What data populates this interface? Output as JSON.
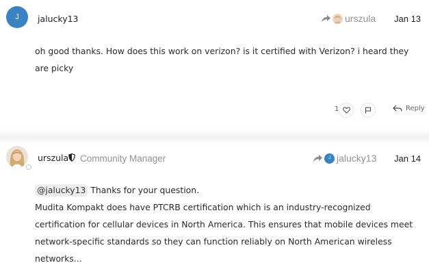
{
  "posts": [
    {
      "author": {
        "username": "jalucky13",
        "avatar_letter": "J",
        "avatar_color": "#3a83c3"
      },
      "reply_to": {
        "username": "urszula",
        "icon": "share-arrow-icon"
      },
      "date": "Jan 13",
      "body": [
        "oh good thanks. How does this work on verizon? is it certified with Verizon? i heard they",
        "are picky"
      ],
      "like_count": "1",
      "reply_label": "Reply"
    },
    {
      "author": {
        "username": "urszula",
        "role": "Community Manager",
        "badge_icon": "shield-icon"
      },
      "reply_to": {
        "username": "jalucky13",
        "avatar_letter": "J",
        "icon": "share-arrow-icon"
      },
      "date": "Jan 14",
      "mention": "@jalucky13",
      "first_line_rest": "Thanks for your question.",
      "body": [
        "Mudita Kompakt does have PTCRB certification which is an industry-recognized",
        "certification for cellular devices in North America. This ensures that mobile devices meet",
        "network-specific standards so they can function reliably on North American wireless",
        "networks..."
      ]
    }
  ],
  "colors": {
    "accent": "#3a83c3",
    "muted": "#919191"
  }
}
